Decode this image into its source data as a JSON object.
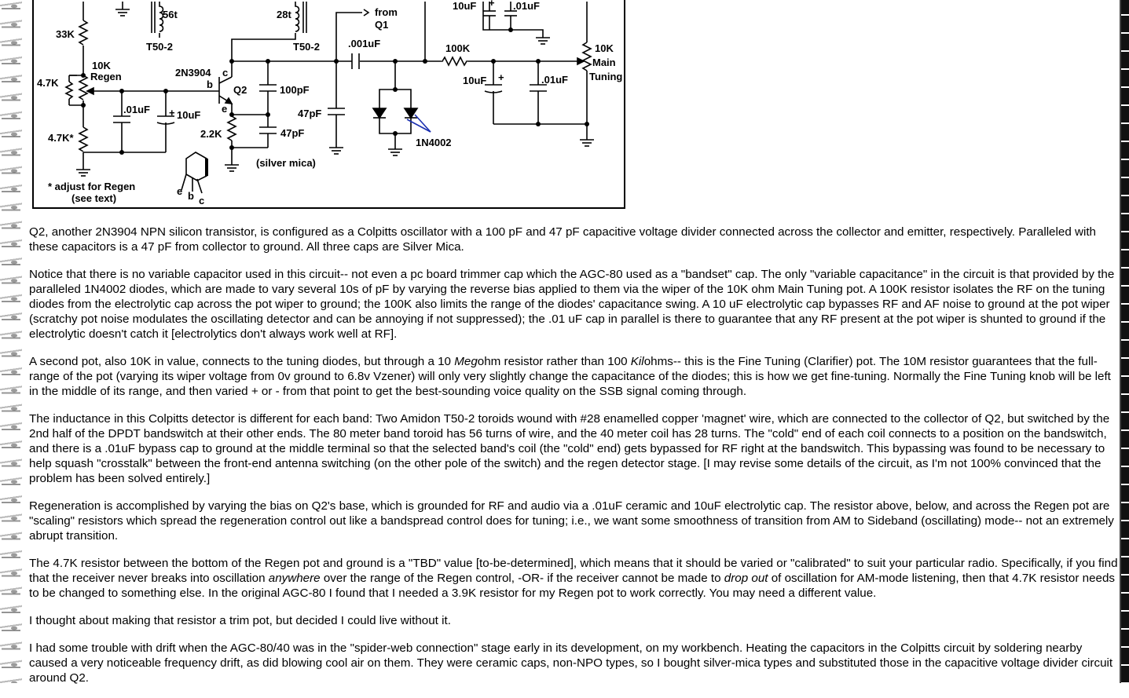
{
  "schematic": {
    "labels": {
      "r33k": "33K",
      "r10k_regen": "10K",
      "regen": "Regen",
      "r47k": "4.7K",
      "r47k_star": "4.7K*",
      "cap01_a": ".01uF",
      "cap10_a": "10uF",
      "plus_a": "+",
      "transistor": "2N3904",
      "q2": "Q2",
      "pin_b": "b",
      "pin_c": "c",
      "pin_e": "e",
      "r22k": "2.2K",
      "c100pf": "100pF",
      "c47pf_a": "47pF",
      "c47pf_b": "47pF",
      "silver_mica": "(silver mica)",
      "c001": ".001uF",
      "r100k": "100K",
      "c10_top": "10uF",
      "plus_top": "+",
      "c01_top": ".01uF",
      "c10_mid": "10uF",
      "plus_mid": "+",
      "c01_mid": ".01uF",
      "r10k_main": "10K",
      "main": "Main",
      "tuning": "Tuning",
      "turns56": "56t",
      "turns28": "28t",
      "t50_a": "T50-2",
      "t50_b": "T50-2",
      "rf_from": "from",
      "rf_q1": "Q1",
      "diode": "1N4002",
      "footnote_1": "* adjust for Regen",
      "footnote_2": "(see text)",
      "pkg_e": "e",
      "pkg_b": "b",
      "pkg_c": "c"
    }
  },
  "paragraphs": {
    "p1": "Q2, another 2N3904 NPN silicon transistor, is configured as a Colpitts oscillator with a 100 pF and 47 pF capacitive voltage divider connected across the collector and emitter, respectively. Paralleled with these capacitors is a 47 pF from collector to ground. All three caps are Silver Mica.",
    "p2": "Notice that there is no variable capacitor used in this circuit-- not even a pc board trimmer cap which the AGC-80 used as a \"bandset\" cap. The only \"variable capacitance\" in the circuit is that provided by the paralleled 1N4002 diodes, which are made to vary several 10s of pF by varying the reverse bias applied to them via the wiper of the 10K ohm Main Tuning pot. A 100K resistor isolates the RF on the tuning diodes from the electrolytic cap across the pot wiper to ground; the 100K also limits the range of the diodes' capacitance swing. A 10 uF electrolytic cap bypasses RF and AF noise to ground at the pot wiper (scratchy pot noise modulates the oscillating detector and can be annoying if not suppressed); the .01 uF cap in parallel is there to guarantee that any RF present at the pot wiper is shunted to ground if the electrolytic doesn't catch it [electrolytics don't always work well at RF].",
    "p3a": "A second pot, also 10K in value, connects to the tuning diodes, but through a 10 ",
    "p3b": "Meg",
    "p3c": "ohm resistor rather than 100 ",
    "p3d": "Kil",
    "p3e": "ohms-- this is the Fine Tuning (Clarifier) pot. The 10M resistor guarantees that the full-range of the pot (varying its wiper voltage from 0v ground to 6.8v Vzener) will only very slightly change the capacitance of the diodes; this is how we get fine-tuning. Normally the Fine Tuning knob will be left in the middle of its range, and then varied + or - from that point to get the best-sounding voice quality on the SSB signal coming through.",
    "p4": "The inductance in this Colpitts detector is different for each band: Two Amidon T50-2 toroids wound with #28 enamelled copper 'magnet' wire, which are connected to the collector of Q2, but switched by the 2nd half of the DPDT bandswitch at their other ends. The 80 meter band toroid has 56 turns of wire, and the 40 meter coil has 28 turns. The \"cold\" end of each coil connects to a position on the bandswitch, and there is a .01uF bypass cap to ground at the middle terminal so that the selected band's coil (the \"cold\" end) gets bypassed for RF right at the bandswitch. This bypassing was found to be necessary to help squash \"crosstalk\" between the front-end antenna switching (on the other pole of the switch) and the regen detector stage. [I may revise some details of the circuit, as I'm not 100% convinced that the problem has been solved entirely.]",
    "p5": "Regeneration is accomplished by varying the bias on Q2's base, which is grounded for RF and audio via a .01uF ceramic and 10uF electrolytic cap. The resistor above, below, and across the Regen pot are \"scaling\" resistors which spread the regeneration control out like a bandspread control does for tuning; i.e., we want some smoothness of transition from AM to Sideband (oscillating) mode-- not an extremely abrupt transition.",
    "p6a": "The 4.7K resistor between the bottom of the Regen pot and ground is a \"TBD\" value [to-be-determined], which means that it should be varied or \"calibrated\" to suit your particular radio. Specifically, if you find that the receiver never breaks into oscillation ",
    "p6b": "anywhere",
    "p6c": " over the range of the Regen control, -OR- if the receiver cannot be made to ",
    "p6d": "drop out",
    "p6e": " of oscillation for AM-mode listening, then that 4.7K resistor needs to be changed to something else. In the original AGC-80 I found that I needed a 3.9K resistor for my Regen pot to work correctly. You may need a different value.",
    "p7": "I thought about making that resistor a trim pot, but decided I could live without it.",
    "p8": "I had some trouble with drift when the AGC-80/40 was in the \"spider-web connection\" stage early in its development, on my workbench. Heating the capacitors in the Colpitts circuit by soldering nearby caused a very noticeable frequency drift, as did blowing cool air on them. They were ceramic caps, non-NPO types, so I bought silver-mica types and substituted those in the capacitive voltage divider circuit around Q2."
  }
}
